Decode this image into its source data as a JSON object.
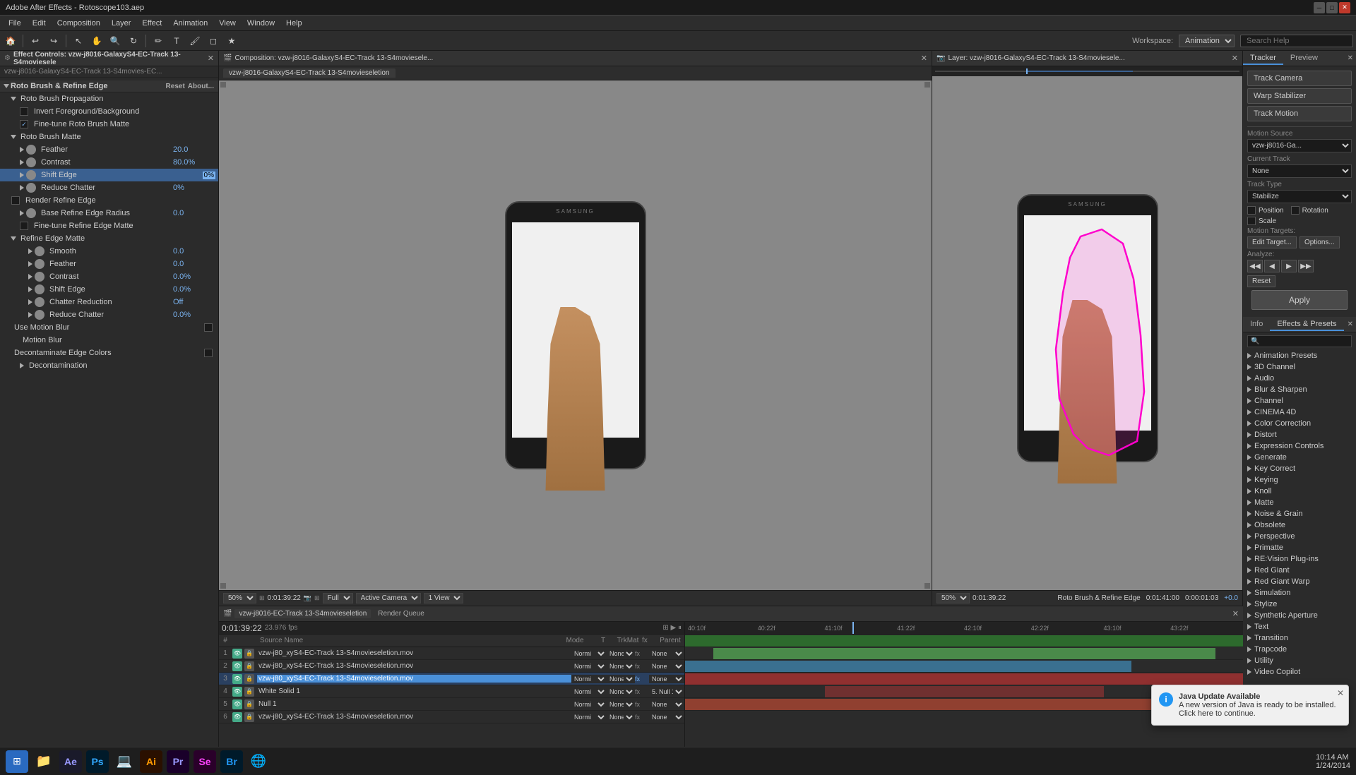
{
  "app": {
    "title": "Adobe After Effects - Rotoscope103.aep",
    "win_controls": [
      "─",
      "□",
      "✕"
    ]
  },
  "menu": {
    "items": [
      "File",
      "Edit",
      "Composition",
      "Layer",
      "Effect",
      "Animation",
      "View",
      "Window",
      "Help"
    ]
  },
  "toolbar": {
    "workspace_label": "Workspace:",
    "workspace_value": "Animation",
    "search_placeholder": "Search Help",
    "search_label": "Search Help"
  },
  "effect_controls": {
    "panel_title": "Effect Controls: vzw-j8016-GalaxyS4-EC-Track 13-S4moviesele...",
    "file_path": "vzw-j8016-GalaxyS4-EC-Track 13-S4movies-EC...",
    "effect_name": "Roto Brush & Refine Edge",
    "reset_label": "Reset",
    "about_label": "About...",
    "sections": [
      {
        "name": "Roto Brush Propagation",
        "indent": 0,
        "open": true
      },
      {
        "name": "Invert Foreground/Background",
        "indent": 1,
        "checkbox": false,
        "value": ""
      },
      {
        "name": "Fine-tune Roto Brush Matte",
        "indent": 1,
        "checkbox": true,
        "value": ""
      },
      {
        "name": "Roto Brush Matte",
        "indent": 0,
        "open": true
      },
      {
        "name": "Feather",
        "indent": 2,
        "value": "20.0"
      },
      {
        "name": "Contrast",
        "indent": 2,
        "value": "80.0%"
      },
      {
        "name": "Shift Edge",
        "indent": 2,
        "value": "0%",
        "highlight": true
      },
      {
        "name": "Reduce Chatter",
        "indent": 2,
        "value": "0%"
      },
      {
        "name": "Render Refine Edge",
        "indent": 1,
        "checkbox": false,
        "value": ""
      },
      {
        "name": "Base Refine Edge Radius",
        "indent": 2,
        "value": "0.0"
      },
      {
        "name": "Fine-tune Refine Edge Matte",
        "indent": 2,
        "checkbox": false,
        "value": ""
      },
      {
        "name": "Refine Edge Matte",
        "indent": 1,
        "open": true
      },
      {
        "name": "Smooth",
        "indent": 3,
        "value": "0.0"
      },
      {
        "name": "Feather",
        "indent": 3,
        "value": "0.0"
      },
      {
        "name": "Contrast",
        "indent": 3,
        "value": "0.0%"
      },
      {
        "name": "Shift Edge",
        "indent": 3,
        "value": "0.0%"
      },
      {
        "name": "Chatter Reduction",
        "indent": 3,
        "value": "Off"
      },
      {
        "name": "Reduce Chatter",
        "indent": 3,
        "value": "0.0%"
      },
      {
        "name": "Use Motion Blur",
        "indent": 1,
        "checkbox": false,
        "value": ""
      },
      {
        "name": "Motion Blur",
        "indent": 2,
        "value": ""
      },
      {
        "name": "Decontaminate Edge Colors",
        "indent": 1,
        "checkbox": false,
        "value": ""
      },
      {
        "name": "Decontamination",
        "indent": 2,
        "value": ""
      }
    ]
  },
  "comp_panel": {
    "title": "Composition: vzw-j8016-GalaxyS4-EC-Track 13-S4moviesele...",
    "tab_label": "vzw-j8016-GalaxyS4-EC-Track 13-S4movieseletion",
    "zoom": "50%",
    "timecode": "0:01:39:22",
    "view_options": [
      "Active Camera",
      "1 View",
      "Full"
    ]
  },
  "layer_panel": {
    "title": "Layer: vzw-j8016-GalaxyS4-EC-Track 13-S4moviesele...",
    "zoom": "50%",
    "timecode": "0:01:39:22",
    "view_label": "Roto Brush & Refine Edge"
  },
  "tracker_panel": {
    "tab_tracker": "Tracker",
    "tab_preview": "Preview",
    "track_camera_label": "Track Camera",
    "warp_stabilizer_label": "Warp Stabilizer",
    "track_motion_label": "Track Motion",
    "stabilize_label": "Stabilize",
    "motion_source_label": "Motion Source",
    "motion_source_value": "vzw-j8016-Ga...",
    "current_track_label": "Current Track",
    "current_track_value": "None",
    "track_type_label": "Track Type",
    "track_type_value": "Stabilize",
    "checkboxes": [
      "Position",
      "Rotation",
      "Scale"
    ],
    "motion_target_label": "Motion Targets:",
    "edit_target_label": "Edit Target...",
    "options_label": "Options...",
    "analyze_label": "Analyze:",
    "reset_label": "Reset",
    "analyze_btns": [
      "◀◀",
      "◀",
      "▶",
      "▶▶"
    ],
    "apply_label": "Apply"
  },
  "effects_presets_panel": {
    "tab_info": "Info",
    "tab_effects": "Effects & Presets",
    "search_placeholder": "🔍",
    "categories": [
      "Animation Presets",
      "3D Channel",
      "Audio",
      "Blur & Sharpen",
      "Channel",
      "CINEMA 4D",
      "Color Correction",
      "Distort",
      "Expression Controls",
      "Generate",
      "Key Correct",
      "Keying",
      "Knoll",
      "Matte",
      "Noise & Grain",
      "Obsolete",
      "Perspective",
      "Primatte",
      "RE:Vision Plug-ins",
      "Red Giant",
      "Red Giant Warp",
      "Simulation",
      "Stylize",
      "Synthetic Aperture",
      "Text",
      "Transition",
      "Trapcode",
      "Utility",
      "Video Copilot"
    ]
  },
  "timeline": {
    "comp_tab": "vzw-j8016-EC-Track 13-S4movieseletion",
    "render_queue_tab": "Render Queue",
    "timecode": "0:01:39:22",
    "fps": "23.976 fps",
    "tracks": [
      {
        "num": "1",
        "name": "vzw-j80_xyS4-EC-Track 13-S4movieseletion.mov",
        "mode": "Normi",
        "color": "#4a8a4a"
      },
      {
        "num": "2",
        "name": "vzw-j80_xyS4-EC-Track 13-S4movieseletion.mov",
        "mode": "Normi",
        "color": "#6aaa6a"
      },
      {
        "num": "3",
        "name": "vzw-j80_xyS4-EC-Track 13-S4movieseletion.mov",
        "mode": "Normi",
        "color": "#4a90d9",
        "selected": true
      },
      {
        "num": "4",
        "name": "White Solid 1",
        "mode": "Normi",
        "color": "#d94a4a"
      },
      {
        "num": "5",
        "name": "Null 1",
        "mode": "Normi",
        "color": "#8a4a4a"
      },
      {
        "num": "6",
        "name": "vzw-j80_xyS4-EC-Track 13-S4movieseletion.mov",
        "mode": "Normi",
        "color": "#d96a4a"
      }
    ]
  },
  "taskbar": {
    "apps": [
      "⊞",
      "📁",
      "Ae",
      "Ps",
      "💻",
      "Ai",
      "Pr",
      "Se",
      "Br"
    ],
    "clock": "10:14 AM\n1/24/2014"
  },
  "notification": {
    "title": "Java Update Available",
    "body": "A new version of Java is ready to be installed. Click here to continue."
  }
}
